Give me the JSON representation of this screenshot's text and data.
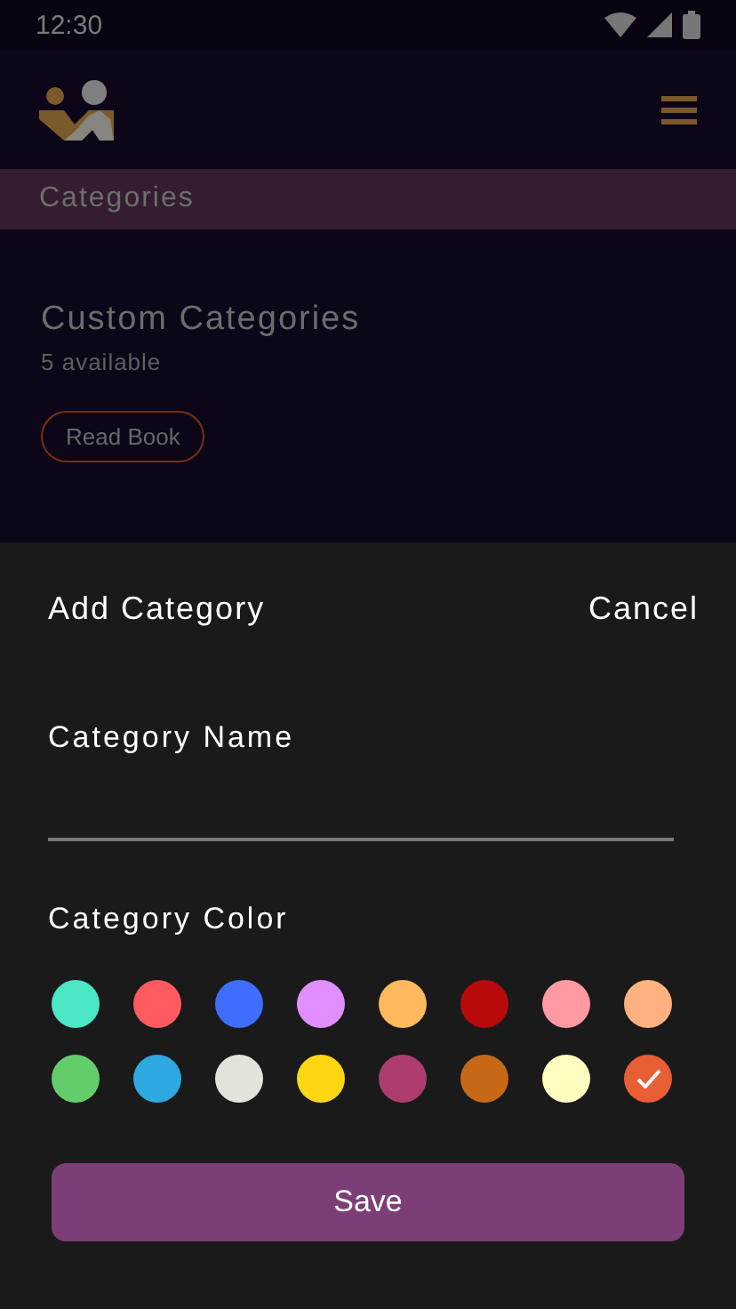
{
  "status_bar": {
    "time": "12:30"
  },
  "section_title": "Categories",
  "card": {
    "title": "Custom Categories",
    "subtitle": "5 available",
    "button": "Read Book"
  },
  "sheet": {
    "title": "Add Category",
    "cancel": "Cancel",
    "name_label": "Category Name",
    "color_label": "Category Color",
    "colors": [
      {
        "color": "#4be6c5",
        "selected": false
      },
      {
        "color": "#fe5b61",
        "selected": false
      },
      {
        "color": "#3f6eff",
        "selected": false
      },
      {
        "color": "#e18eff",
        "selected": false
      },
      {
        "color": "#ffb95d",
        "selected": false
      },
      {
        "color": "#b80a0a",
        "selected": false
      },
      {
        "color": "#ff9aa2",
        "selected": false
      },
      {
        "color": "#ffb27f",
        "selected": false
      },
      {
        "color": "#64cd6b",
        "selected": false
      },
      {
        "color": "#2da8e0",
        "selected": false
      },
      {
        "color": "#e3e3dc",
        "selected": false
      },
      {
        "color": "#fed612",
        "selected": false
      },
      {
        "color": "#ae3c6f",
        "selected": false
      },
      {
        "color": "#c66816",
        "selected": false
      },
      {
        "color": "#fffdbf",
        "selected": false
      },
      {
        "color": "#e85f35",
        "selected": true
      }
    ],
    "save": "Save"
  }
}
